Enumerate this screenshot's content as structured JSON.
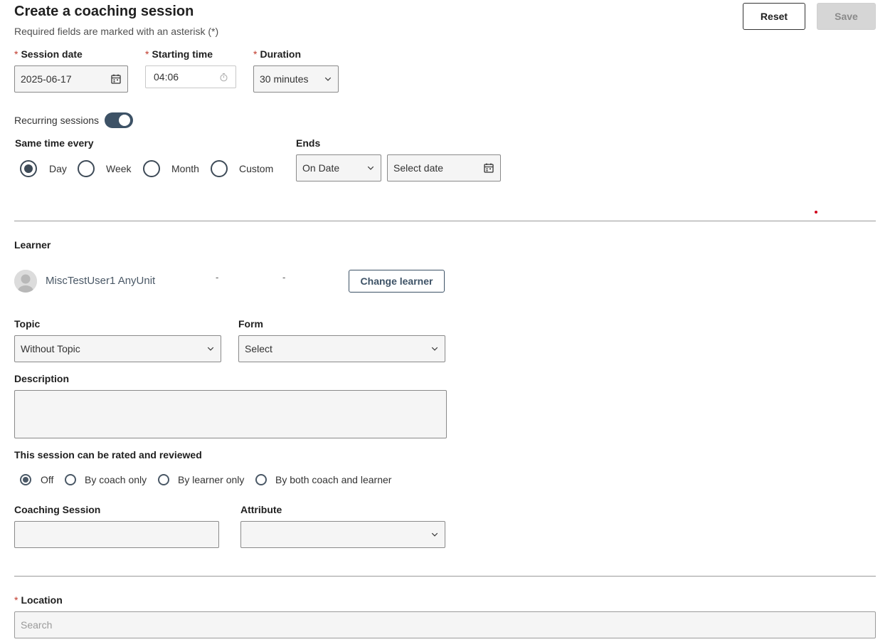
{
  "header": {
    "title": "Create a coaching session",
    "subtitle": "Required fields are marked with an asterisk (*)",
    "reset_label": "Reset",
    "save_label": "Save"
  },
  "required_marker": "*",
  "session_date": {
    "label": "Session date",
    "value": "2025-06-17",
    "icon": "calendar-icon"
  },
  "starting_time": {
    "label": "Starting time",
    "value": "04:06",
    "icon": "stopwatch-icon"
  },
  "duration": {
    "label": "Duration",
    "value": "30 minutes",
    "icon": "chevron-down-icon"
  },
  "recurring": {
    "label": "Recurring sessions",
    "enabled": true,
    "toggle_color": "#3d5266"
  },
  "same_time_every": {
    "label": "Same time every",
    "options": [
      "Day",
      "Week",
      "Month",
      "Custom"
    ],
    "selected": "Day"
  },
  "ends": {
    "label": "Ends",
    "type_value": "On Date",
    "date_placeholder": "Select date"
  },
  "learner": {
    "label": "Learner",
    "name": "MiscTestUser1 AnyUnit",
    "dash1": "-",
    "dash2": "-",
    "change_label": "Change learner"
  },
  "topic": {
    "label": "Topic",
    "value": "Without Topic"
  },
  "form": {
    "label": "Form",
    "value": "Select"
  },
  "description": {
    "label": "Description",
    "value": ""
  },
  "rating": {
    "label": "This session can be rated and reviewed",
    "options": [
      "Off",
      "By coach only",
      "By learner only",
      "By both coach and learner"
    ],
    "selected": "Off"
  },
  "coaching_session": {
    "label": "Coaching Session",
    "value": ""
  },
  "attribute": {
    "label": "Attribute",
    "value": ""
  },
  "location": {
    "label": "Location",
    "placeholder": "Search"
  },
  "colors": {
    "accent": "#3d5266",
    "required": "#c0392b",
    "field_bg": "#f5f5f5"
  }
}
